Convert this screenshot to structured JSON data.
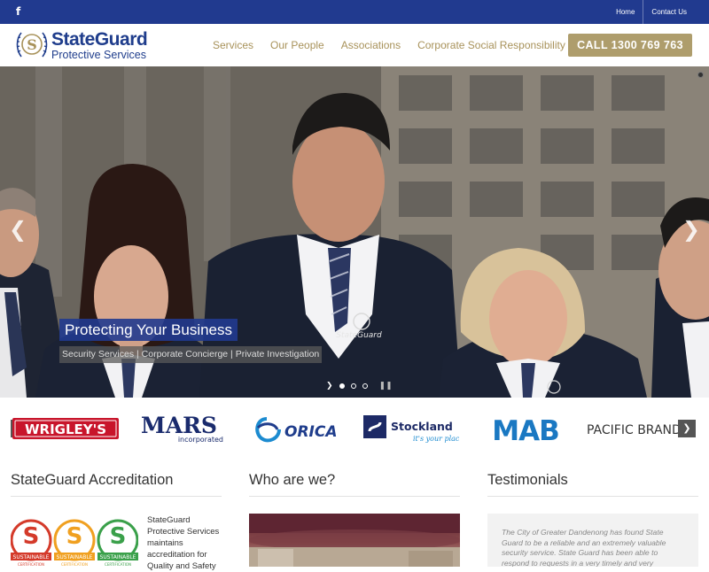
{
  "topbar": {
    "facebook_glyph": "f",
    "links": [
      "Home",
      "Contact Us"
    ]
  },
  "header": {
    "logo_name": "StateGuard",
    "logo_tagline": "Protective Services",
    "nav": [
      "Services",
      "Our People",
      "Associations",
      "Corporate Social Responsibility"
    ],
    "call_label": "CALL 1300 769 763"
  },
  "hero": {
    "title": "Protecting Your Business",
    "subtitle": "Security Services | Corporate Concierge | Private Investigation",
    "badge_text": "StateGuard",
    "slide_count": 3,
    "active_slide": 1
  },
  "clients": [
    "WRIGLEY'S",
    "MARS",
    "incorporated",
    "ORICA",
    "Stockland",
    "it's your place",
    "MAB",
    "PACIFIC BRANDS"
  ],
  "sections": {
    "accreditation": {
      "title": "StateGuard Accreditation",
      "text": "StateGuard Protective Services maintains accreditation for Quality and Safety",
      "badge_label": "SUSTAINABLE",
      "badge_sub": "CERTIFICATION"
    },
    "who": {
      "title": "Who are we?"
    },
    "testimonials": {
      "title": "Testimonials",
      "quote": "The City of Greater Dandenong has found State Guard to be a reliable and an extremely valuable security service. State Guard has been able to respond to requests in a very timely and very"
    }
  },
  "colors": {
    "brand_blue": "#213a8f",
    "gold": "#ae9d6c",
    "nav_gold": "#a8925a"
  },
  "icons": [
    "facebook-icon",
    "chevron-left-icon",
    "chevron-right-icon",
    "play-icon",
    "pause-icon"
  ]
}
